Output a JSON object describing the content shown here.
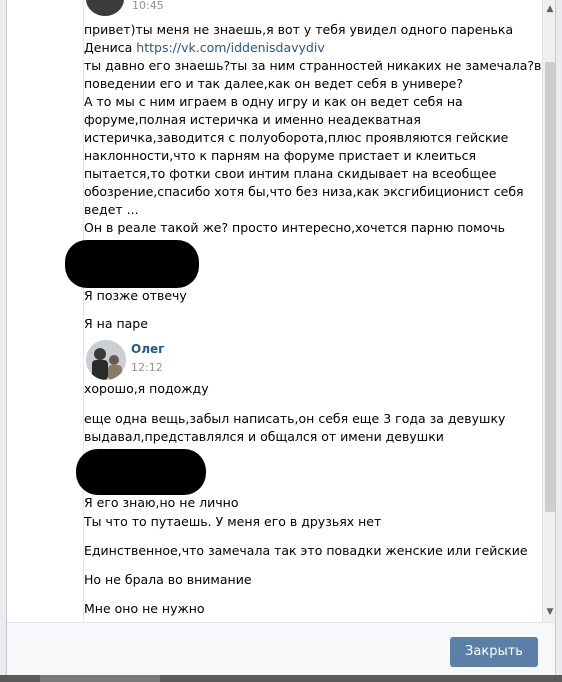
{
  "dialog": {
    "close_button": "Закрыть"
  },
  "messages": {
    "first_time": "10:45",
    "first_lines": [
      "привет)ты меня не знаешь,я вот у тебя увидел одного паренька",
      "Дениса",
      "ты давно его знаешь?ты за ним странностей никаких не замечала?в",
      "поведении его и так далее,как он ведет себя в универе?",
      "А то мы с ним играем в одну игру и как он ведет себя на",
      "форуме,полная истеричка и именно неадекватная",
      "истеричка,заводится с полуоборота,плюс проявляются гейские",
      "наклонности,что к парням на форуме пристает и клеиться",
      "пытается,то фотки свои интим плана скидывает на всеобщее",
      "обозрение,спасибо хотя бы,что без низа,как эксгибиционист себя",
      "ведет ...",
      "Он в реале такой же? просто интересно,хочется парню помочь"
    ],
    "first_link": "https://vk.com/iddenisdavydiv",
    "reply1": "Я позже отвечу",
    "reply2": "Я на паре",
    "oleg_name": "Олег",
    "oleg_time": "12:12",
    "oleg_msg1": "хорошо,я подожду",
    "oleg_msg2_line1": "еще одна вещь,забыл написать,он себя еще 3 года за девушку",
    "oleg_msg2_line2": "выдавал,представлялся и общался от имени девушки",
    "reply3": "Я его знаю,но не лично",
    "reply4": "Ты что то путаешь. У меня его в друзьях нет",
    "reply5": "Единственное,что замечала так это повадки женские или гейские",
    "reply6": "Но не брала во внимание",
    "reply7": "Мне оно не нужно"
  },
  "icons": {
    "scroll_up": "arrow-up",
    "scroll_down": "arrow-down"
  }
}
